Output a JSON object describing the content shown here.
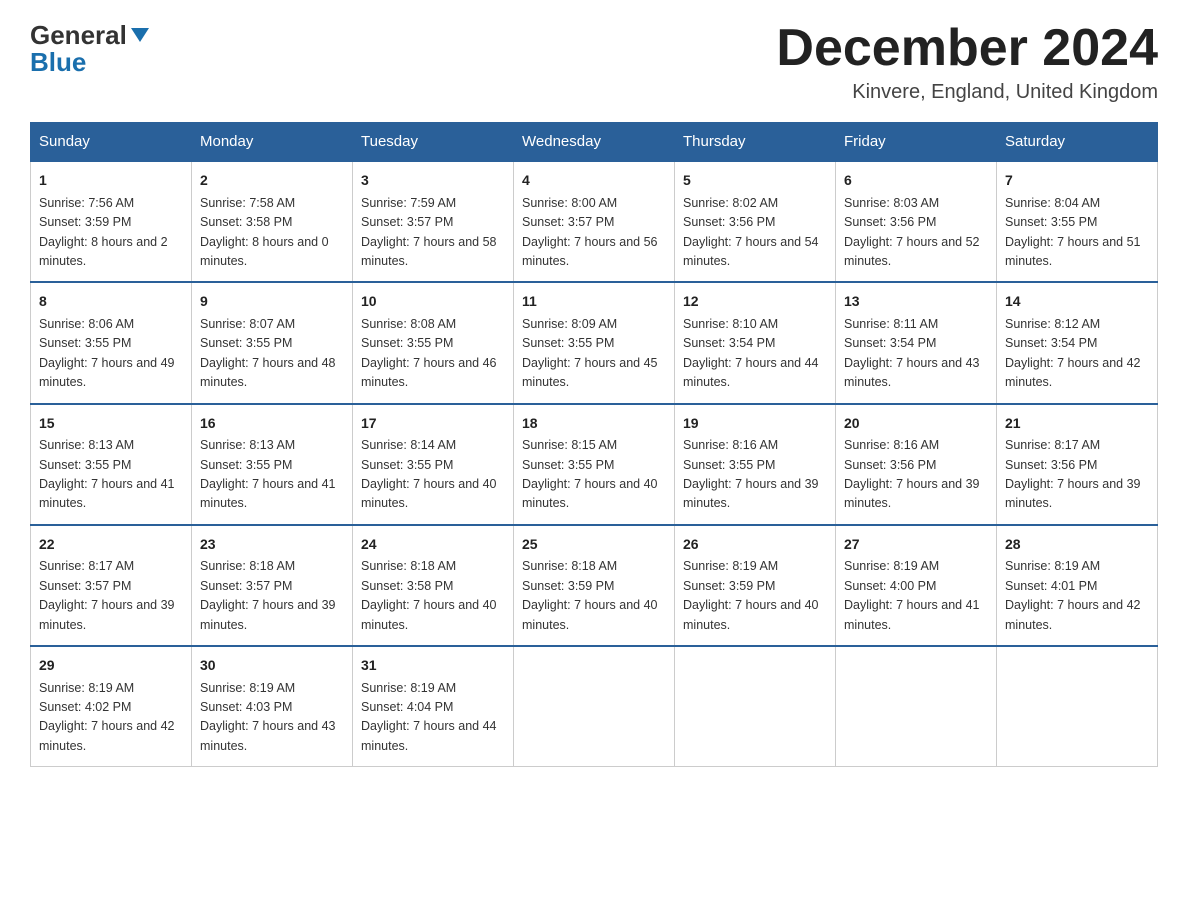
{
  "header": {
    "logo_line1": "General",
    "logo_line2": "Blue",
    "month_title": "December 2024",
    "location": "Kinvere, England, United Kingdom"
  },
  "days_of_week": [
    "Sunday",
    "Monday",
    "Tuesday",
    "Wednesday",
    "Thursday",
    "Friday",
    "Saturday"
  ],
  "weeks": [
    [
      {
        "day": "1",
        "sunrise": "7:56 AM",
        "sunset": "3:59 PM",
        "daylight": "8 hours and 2 minutes."
      },
      {
        "day": "2",
        "sunrise": "7:58 AM",
        "sunset": "3:58 PM",
        "daylight": "8 hours and 0 minutes."
      },
      {
        "day": "3",
        "sunrise": "7:59 AM",
        "sunset": "3:57 PM",
        "daylight": "7 hours and 58 minutes."
      },
      {
        "day": "4",
        "sunrise": "8:00 AM",
        "sunset": "3:57 PM",
        "daylight": "7 hours and 56 minutes."
      },
      {
        "day": "5",
        "sunrise": "8:02 AM",
        "sunset": "3:56 PM",
        "daylight": "7 hours and 54 minutes."
      },
      {
        "day": "6",
        "sunrise": "8:03 AM",
        "sunset": "3:56 PM",
        "daylight": "7 hours and 52 minutes."
      },
      {
        "day": "7",
        "sunrise": "8:04 AM",
        "sunset": "3:55 PM",
        "daylight": "7 hours and 51 minutes."
      }
    ],
    [
      {
        "day": "8",
        "sunrise": "8:06 AM",
        "sunset": "3:55 PM",
        "daylight": "7 hours and 49 minutes."
      },
      {
        "day": "9",
        "sunrise": "8:07 AM",
        "sunset": "3:55 PM",
        "daylight": "7 hours and 48 minutes."
      },
      {
        "day": "10",
        "sunrise": "8:08 AM",
        "sunset": "3:55 PM",
        "daylight": "7 hours and 46 minutes."
      },
      {
        "day": "11",
        "sunrise": "8:09 AM",
        "sunset": "3:55 PM",
        "daylight": "7 hours and 45 minutes."
      },
      {
        "day": "12",
        "sunrise": "8:10 AM",
        "sunset": "3:54 PM",
        "daylight": "7 hours and 44 minutes."
      },
      {
        "day": "13",
        "sunrise": "8:11 AM",
        "sunset": "3:54 PM",
        "daylight": "7 hours and 43 minutes."
      },
      {
        "day": "14",
        "sunrise": "8:12 AM",
        "sunset": "3:54 PM",
        "daylight": "7 hours and 42 minutes."
      }
    ],
    [
      {
        "day": "15",
        "sunrise": "8:13 AM",
        "sunset": "3:55 PM",
        "daylight": "7 hours and 41 minutes."
      },
      {
        "day": "16",
        "sunrise": "8:13 AM",
        "sunset": "3:55 PM",
        "daylight": "7 hours and 41 minutes."
      },
      {
        "day": "17",
        "sunrise": "8:14 AM",
        "sunset": "3:55 PM",
        "daylight": "7 hours and 40 minutes."
      },
      {
        "day": "18",
        "sunrise": "8:15 AM",
        "sunset": "3:55 PM",
        "daylight": "7 hours and 40 minutes."
      },
      {
        "day": "19",
        "sunrise": "8:16 AM",
        "sunset": "3:55 PM",
        "daylight": "7 hours and 39 minutes."
      },
      {
        "day": "20",
        "sunrise": "8:16 AM",
        "sunset": "3:56 PM",
        "daylight": "7 hours and 39 minutes."
      },
      {
        "day": "21",
        "sunrise": "8:17 AM",
        "sunset": "3:56 PM",
        "daylight": "7 hours and 39 minutes."
      }
    ],
    [
      {
        "day": "22",
        "sunrise": "8:17 AM",
        "sunset": "3:57 PM",
        "daylight": "7 hours and 39 minutes."
      },
      {
        "day": "23",
        "sunrise": "8:18 AM",
        "sunset": "3:57 PM",
        "daylight": "7 hours and 39 minutes."
      },
      {
        "day": "24",
        "sunrise": "8:18 AM",
        "sunset": "3:58 PM",
        "daylight": "7 hours and 40 minutes."
      },
      {
        "day": "25",
        "sunrise": "8:18 AM",
        "sunset": "3:59 PM",
        "daylight": "7 hours and 40 minutes."
      },
      {
        "day": "26",
        "sunrise": "8:19 AM",
        "sunset": "3:59 PM",
        "daylight": "7 hours and 40 minutes."
      },
      {
        "day": "27",
        "sunrise": "8:19 AM",
        "sunset": "4:00 PM",
        "daylight": "7 hours and 41 minutes."
      },
      {
        "day": "28",
        "sunrise": "8:19 AM",
        "sunset": "4:01 PM",
        "daylight": "7 hours and 42 minutes."
      }
    ],
    [
      {
        "day": "29",
        "sunrise": "8:19 AM",
        "sunset": "4:02 PM",
        "daylight": "7 hours and 42 minutes."
      },
      {
        "day": "30",
        "sunrise": "8:19 AM",
        "sunset": "4:03 PM",
        "daylight": "7 hours and 43 minutes."
      },
      {
        "day": "31",
        "sunrise": "8:19 AM",
        "sunset": "4:04 PM",
        "daylight": "7 hours and 44 minutes."
      },
      null,
      null,
      null,
      null
    ]
  ],
  "labels": {
    "sunrise": "Sunrise:",
    "sunset": "Sunset:",
    "daylight": "Daylight:"
  }
}
